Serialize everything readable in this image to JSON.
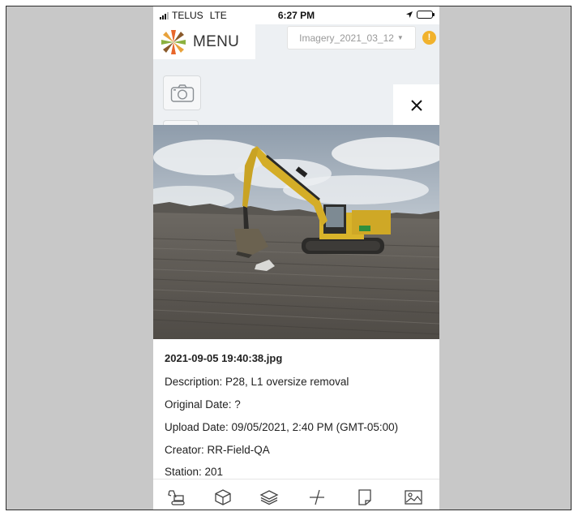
{
  "status_bar": {
    "carrier": "TELUS",
    "network": "LTE",
    "time": "6:27 PM"
  },
  "header": {
    "menu_label": "MENU",
    "imagery_selected": "Imagery_2021_03_12",
    "alert_symbol": "!"
  },
  "viewer": {
    "close_symbol": "✕"
  },
  "image_details": {
    "filename": "2021-09-05 19:40:38.jpg",
    "description": "Description: P28, L1 oversize removal",
    "original_date": "Original Date: ?",
    "upload_date": "Upload Date: 09/05/2021, 2:40 PM (GMT-05:00)",
    "creator": "Creator: RR-Field-QA",
    "station": "Station: 201"
  },
  "toolbar": {
    "icons": [
      "excavator-icon",
      "box-3d-icon",
      "layers-icon",
      "measure-icon",
      "document-icon",
      "image-icon"
    ]
  },
  "colors": {
    "accent_alert": "#f1b22d",
    "logo_orange": "#e8672b",
    "logo_green": "#8bb13f",
    "logo_brown": "#8a5a2b",
    "machine_yellow": "#d9b42a"
  }
}
